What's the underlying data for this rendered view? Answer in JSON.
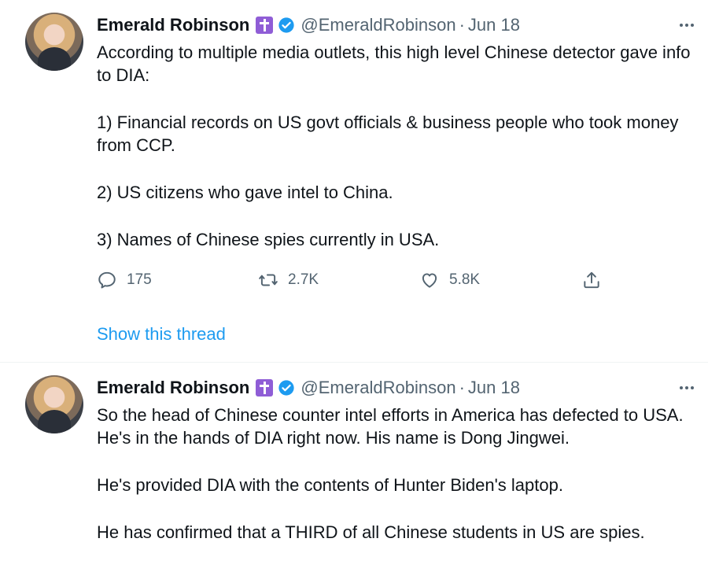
{
  "tweets": [
    {
      "name": "Emerald Robinson",
      "handle": "@EmeraldRobinson",
      "separator": "·",
      "date": "Jun 18",
      "paragraphs": [
        "According to multiple media outlets, this high level Chinese detector gave info to DIA:",
        "1) Financial records on US govt officials & business people who took money from CCP.",
        "2) US citizens who gave intel to China.",
        "3) Names of Chinese spies currently in USA."
      ],
      "actions": {
        "replies": "175",
        "retweets": "2.7K",
        "likes": "5.8K"
      },
      "show_thread": "Show this thread"
    },
    {
      "name": "Emerald Robinson",
      "handle": "@EmeraldRobinson",
      "separator": "·",
      "date": "Jun 18",
      "paragraphs": [
        "So the head of Chinese counter intel efforts in America has defected to USA. He's in the hands of DIA right now. His name is Dong Jingwei.",
        "He's provided DIA with the contents of Hunter Biden's laptop.",
        "He has confirmed that a THIRD of all Chinese students in US are spies."
      ]
    }
  ],
  "colors": {
    "text": "#0f1419",
    "secondary": "#536471",
    "link": "#1d9bf0",
    "verified": "#1d9bf0",
    "cross_badge": "#8f5dd6",
    "divider": "#eff3f4"
  },
  "icons": {
    "reply": "reply-icon",
    "retweet": "retweet-icon",
    "like": "heart-icon",
    "share": "share-icon",
    "verified": "verified-badge-icon",
    "cross": "cross-emoji-icon",
    "more": "more-options-icon"
  }
}
